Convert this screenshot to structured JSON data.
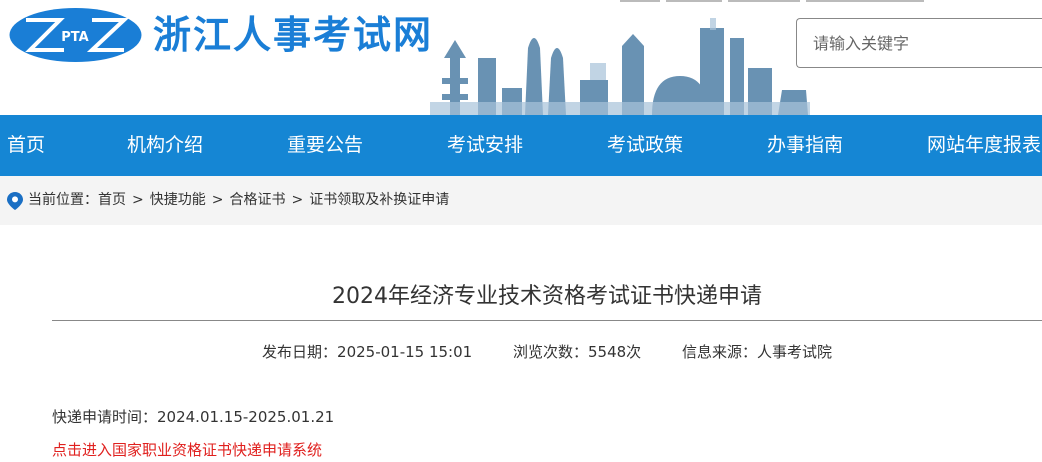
{
  "header": {
    "logo_text": "PTA",
    "site_name": "浙江人事考试网",
    "search_placeholder": "请输入关键字"
  },
  "nav": {
    "items": [
      "首页",
      "机构介绍",
      "重要公告",
      "考试安排",
      "考试政策",
      "办事指南",
      "网站年度报表"
    ]
  },
  "breadcrumb": {
    "prefix": "当前位置：",
    "items": [
      "首页",
      "快捷功能",
      "合格证书",
      "证书领取及补换证申请"
    ]
  },
  "article": {
    "title": "2024年经济专业技术资格考试证书快递申请",
    "publish_date": "发布日期：2025-01-15 15:01",
    "views": "浏览次数：5548次",
    "source": "信息来源：人事考试院",
    "apply_time": "快递申请时间：2024.01.15-2025.01.21",
    "apply_link": "点击进入国家职业资格证书快递申请系统"
  },
  "colors": {
    "brand_blue": "#1586d4",
    "link_red": "#e0201e"
  }
}
